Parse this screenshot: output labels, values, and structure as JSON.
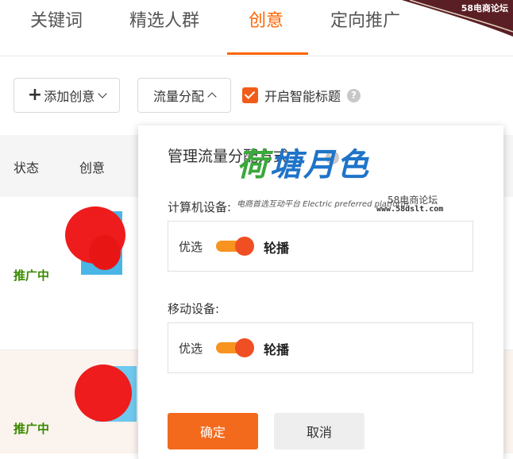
{
  "tabs": [
    {
      "label": "关键词",
      "active": false
    },
    {
      "label": "精选人群",
      "active": false
    },
    {
      "label": "创意",
      "active": true
    },
    {
      "label": "定向推广",
      "active": false
    }
  ],
  "corner_watermark": "58电商论坛",
  "toolbar": {
    "add_creative": "添加创意",
    "flow_allocation": "流量分配",
    "smart_title_checkbox": "开启智能标题",
    "smart_title_checked": true
  },
  "table": {
    "headers": [
      "状态",
      "创意"
    ],
    "rows": [
      {
        "status": "推广中"
      },
      {
        "status": "推广中"
      }
    ]
  },
  "panel": {
    "title": "管理流量分配方式",
    "devices": [
      {
        "label": "计算机设备:",
        "option_left": "优选",
        "option_right": "轮播",
        "selected": "轮播"
      },
      {
        "label": "移动设备:",
        "option_left": "优选",
        "option_right": "轮播",
        "selected": "轮播"
      }
    ],
    "confirm": "确定",
    "cancel": "取消"
  },
  "watermark": {
    "logo_green": "荷",
    "logo_blue": "塘月色",
    "subtitle": "电商首选互动平台 Electric preferred platform",
    "forum": "58电商论坛",
    "url": "www.58dslt.com"
  },
  "colors": {
    "accent": "#ff6600",
    "toggle_track": "#f7931e",
    "toggle_knob": "#f04e23",
    "status_green": "#3a8a00",
    "confirm_button": "#f36a1d"
  }
}
